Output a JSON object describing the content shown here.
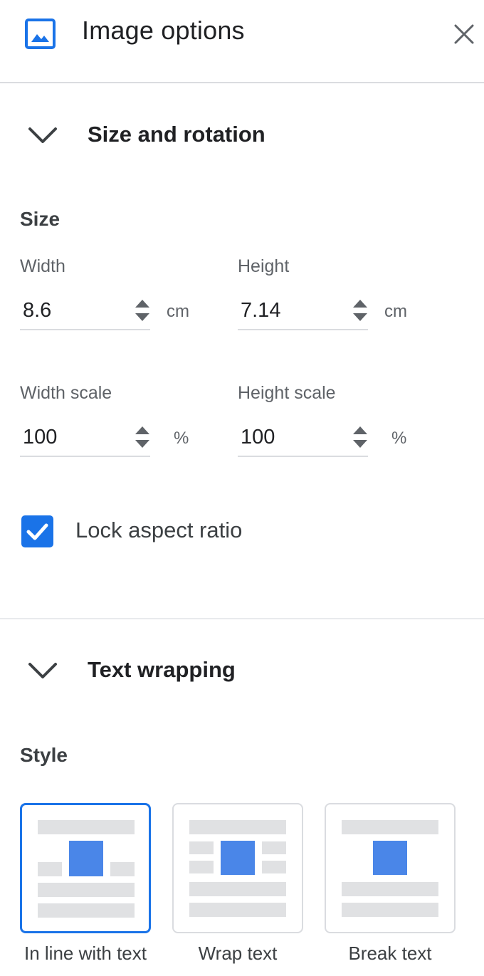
{
  "header": {
    "title": "Image options",
    "icon": "image-icon",
    "close_icon": "close-icon"
  },
  "colors": {
    "accent": "#1a73e8",
    "wrap_image": "#4a86e8",
    "wrap_lines": "#e0e1e3",
    "divider": "#dadce0"
  },
  "size_rotation": {
    "title": "Size and rotation",
    "size_heading": "Size",
    "width": {
      "label": "Width",
      "value": "8.6",
      "unit": "cm"
    },
    "height": {
      "label": "Height",
      "value": "7.14",
      "unit": "cm"
    },
    "width_scale": {
      "label": "Width scale",
      "value": "100",
      "unit": "%"
    },
    "height_scale": {
      "label": "Height scale",
      "value": "100",
      "unit": "%"
    },
    "lock_aspect": {
      "label": "Lock aspect ratio",
      "checked": true
    }
  },
  "text_wrapping": {
    "title": "Text wrapping",
    "style_heading": "Style",
    "options": [
      {
        "label": "In line with text",
        "selected": true
      },
      {
        "label": "Wrap text",
        "selected": false
      },
      {
        "label": "Break text",
        "selected": false
      }
    ]
  }
}
